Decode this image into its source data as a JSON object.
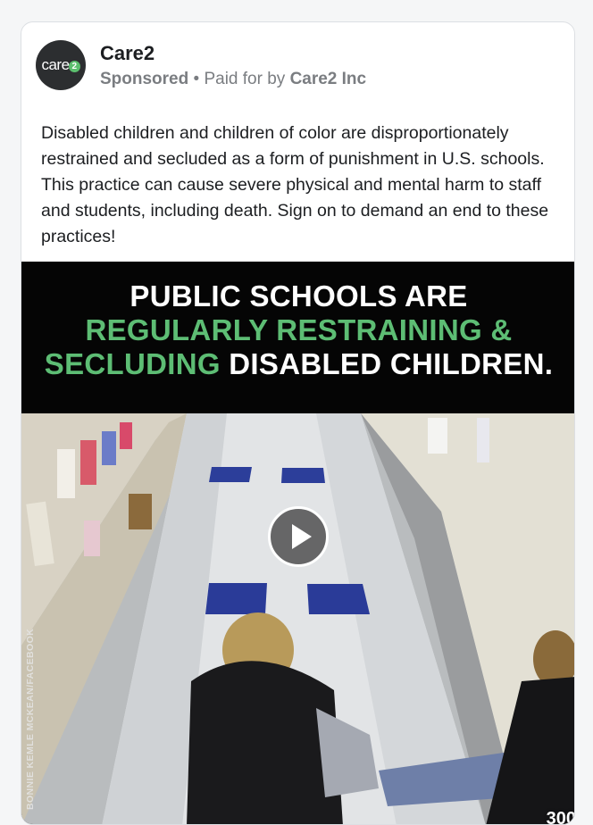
{
  "post": {
    "page_name": "Care2",
    "avatar_text": "care",
    "avatar_badge": "2",
    "sponsored": "Sponsored",
    "separator": " • ",
    "paid_for_by": "Paid for by ",
    "advertiser": "Care2 Inc",
    "body": "Disabled children and children of color are disproportionately restrained and secluded as a form of punishment in U.S. schools. This practice can cause severe physical and mental harm to staff and students, including death. Sign on to demand an end to these practices!"
  },
  "video": {
    "banner_line1": "PUBLIC SCHOOLS ARE",
    "banner_line2": "REGULARLY RESTRAINING &",
    "banner_line3_green": "SECLUDING",
    "banner_line3_white": " DISABLED CHILDREN.",
    "credit": "BONNIE KEMLE MCKEAN/FACEBOOK",
    "timer": "300",
    "play_icon": "play-icon"
  },
  "colors": {
    "accent_green": "#5dbd74",
    "avatar_bg": "#2c2e30",
    "meta_gray": "#7a7d81"
  }
}
